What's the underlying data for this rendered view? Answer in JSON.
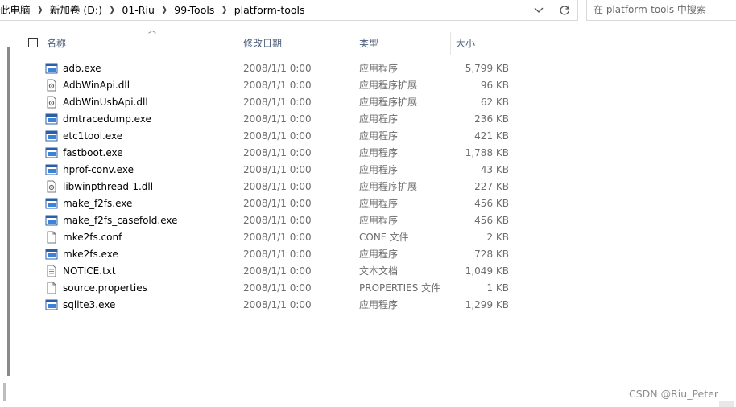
{
  "breadcrumb": [
    "此电脑",
    "新加卷 (D:)",
    "01-Riu",
    "99-Tools",
    "platform-tools"
  ],
  "search": {
    "placeholder": "在 platform-tools 中搜索"
  },
  "columns": {
    "name": "名称",
    "date": "修改日期",
    "type": "类型",
    "size": "大小"
  },
  "files": [
    {
      "name": "adb.exe",
      "date": "2008/1/1 0:00",
      "type": "应用程序",
      "size": "5,799 KB",
      "icon": "exe-icon"
    },
    {
      "name": "AdbWinApi.dll",
      "date": "2008/1/1 0:00",
      "type": "应用程序扩展",
      "size": "96 KB",
      "icon": "dll-icon"
    },
    {
      "name": "AdbWinUsbApi.dll",
      "date": "2008/1/1 0:00",
      "type": "应用程序扩展",
      "size": "62 KB",
      "icon": "dll-icon"
    },
    {
      "name": "dmtracedump.exe",
      "date": "2008/1/1 0:00",
      "type": "应用程序",
      "size": "236 KB",
      "icon": "exe-icon"
    },
    {
      "name": "etc1tool.exe",
      "date": "2008/1/1 0:00",
      "type": "应用程序",
      "size": "421 KB",
      "icon": "exe-icon"
    },
    {
      "name": "fastboot.exe",
      "date": "2008/1/1 0:00",
      "type": "应用程序",
      "size": "1,788 KB",
      "icon": "exe-icon"
    },
    {
      "name": "hprof-conv.exe",
      "date": "2008/1/1 0:00",
      "type": "应用程序",
      "size": "43 KB",
      "icon": "exe-icon"
    },
    {
      "name": "libwinpthread-1.dll",
      "date": "2008/1/1 0:00",
      "type": "应用程序扩展",
      "size": "227 KB",
      "icon": "dll-icon"
    },
    {
      "name": "make_f2fs.exe",
      "date": "2008/1/1 0:00",
      "type": "应用程序",
      "size": "456 KB",
      "icon": "exe-icon"
    },
    {
      "name": "make_f2fs_casefold.exe",
      "date": "2008/1/1 0:00",
      "type": "应用程序",
      "size": "456 KB",
      "icon": "exe-icon"
    },
    {
      "name": "mke2fs.conf",
      "date": "2008/1/1 0:00",
      "type": "CONF 文件",
      "size": "2 KB",
      "icon": "file-icon"
    },
    {
      "name": "mke2fs.exe",
      "date": "2008/1/1 0:00",
      "type": "应用程序",
      "size": "728 KB",
      "icon": "exe-icon"
    },
    {
      "name": "NOTICE.txt",
      "date": "2008/1/1 0:00",
      "type": "文本文档",
      "size": "1,049 KB",
      "icon": "text-file-icon"
    },
    {
      "name": "source.properties",
      "date": "2008/1/1 0:00",
      "type": "PROPERTIES 文件",
      "size": "1 KB",
      "icon": "file-icon"
    },
    {
      "name": "sqlite3.exe",
      "date": "2008/1/1 0:00",
      "type": "应用程序",
      "size": "1,299 KB",
      "icon": "exe-icon"
    }
  ],
  "watermark": "CSDN @Riu_Peter"
}
